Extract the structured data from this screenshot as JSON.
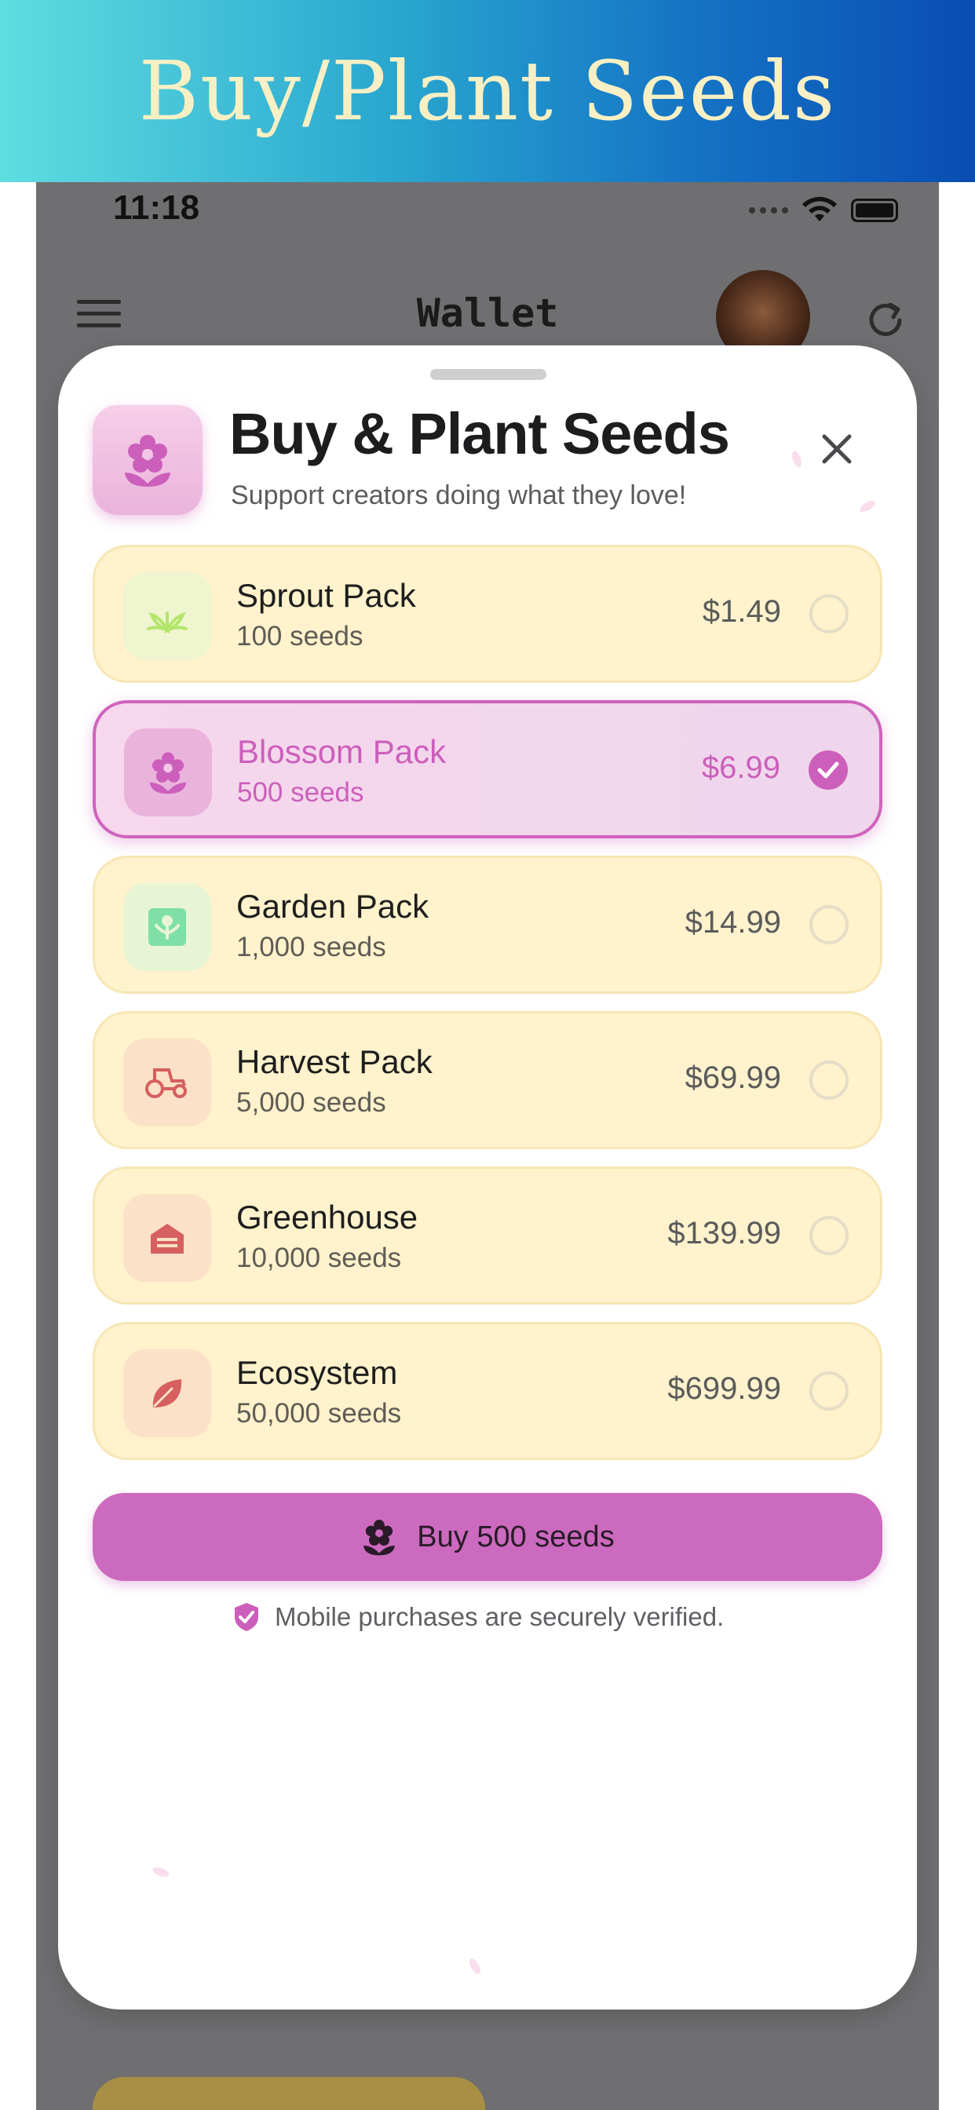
{
  "banner": {
    "title": "Buy/Plant Seeds"
  },
  "status_bar": {
    "time": "11:18"
  },
  "nav": {
    "title": "Wallet"
  },
  "sheet": {
    "title": "Buy & Plant Seeds",
    "subtitle": "Support creators doing what they love!",
    "packs": [
      {
        "name": "Sprout Pack",
        "seeds": "100 seeds",
        "price": "$1.49",
        "icon": "sprout-icon",
        "selected": false
      },
      {
        "name": "Blossom Pack",
        "seeds": "500 seeds",
        "price": "$6.99",
        "icon": "flower-icon",
        "selected": true
      },
      {
        "name": "Garden Pack",
        "seeds": "1,000 seeds",
        "price": "$14.99",
        "icon": "garden-icon",
        "selected": false
      },
      {
        "name": "Harvest Pack",
        "seeds": "5,000 seeds",
        "price": "$69.99",
        "icon": "tractor-icon",
        "selected": false
      },
      {
        "name": "Greenhouse",
        "seeds": "10,000 seeds",
        "price": "$139.99",
        "icon": "greenhouse-icon",
        "selected": false
      },
      {
        "name": "Ecosystem",
        "seeds": "50,000 seeds",
        "price": "$699.99",
        "icon": "leaf-icon",
        "selected": false
      }
    ],
    "buy_button": "Buy 500 seeds",
    "secure_note": "Mobile purchases are securely verified."
  },
  "colors": {
    "accent": "#cc5fbb",
    "pack_bg": "#fff2cc",
    "banner_gradient_start": "#5fdde0",
    "banner_gradient_end": "#0a4db3"
  }
}
